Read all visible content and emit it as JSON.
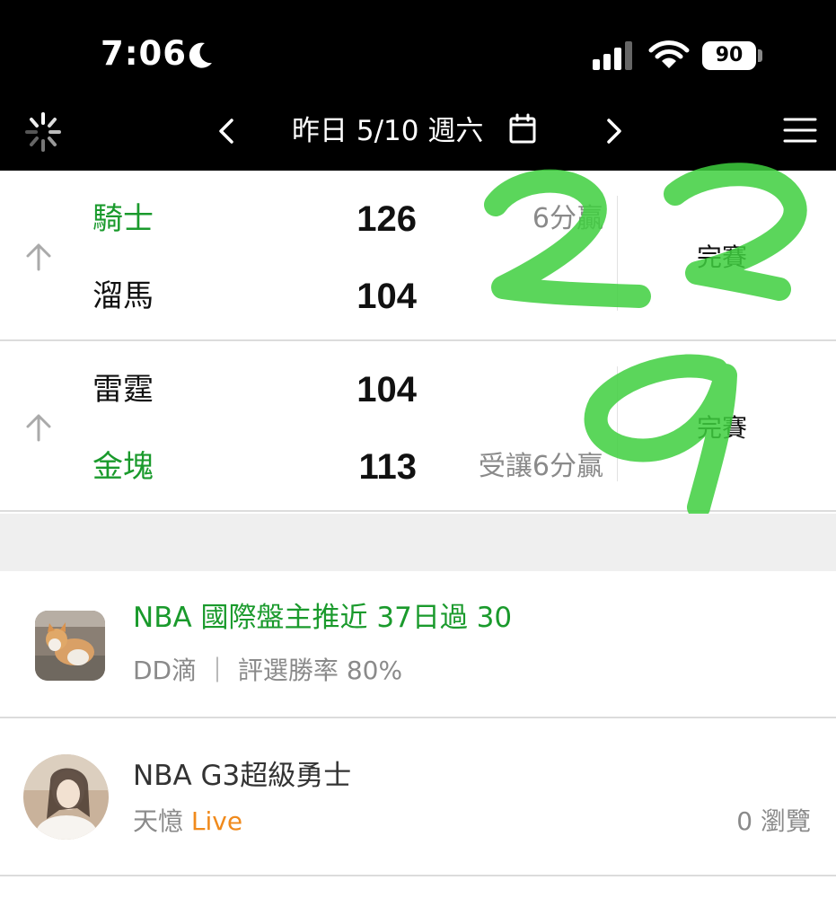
{
  "status_bar": {
    "time": "7:06",
    "battery": "90"
  },
  "nav": {
    "date_title": "昨日 5/10 週六"
  },
  "games": [
    {
      "team_top": "騎士",
      "score_top": "126",
      "result_top": "6分贏",
      "team_bottom": "溜馬",
      "score_bottom": "104",
      "result_bottom": "",
      "status": "完賽",
      "annotation": "22"
    },
    {
      "team_top": "雷霆",
      "score_top": "104",
      "result_top": "",
      "team_bottom": "金塊",
      "score_bottom": "113",
      "result_bottom": "受讓6分贏",
      "status": "完賽",
      "annotation": "9"
    }
  ],
  "articles": [
    {
      "title": "NBA 國際盤主推近 37日過 30",
      "author": "DD滴",
      "meta": "｜ 評選勝率 80%"
    },
    {
      "title": "NBA G3超級勇士",
      "author": "天憶",
      "live": "Live",
      "views": "0 瀏覽"
    }
  ],
  "colors": {
    "win_green": "#1a9a2c",
    "live_orange": "#f08a1c",
    "handwriting_green": "#3ecf3e"
  }
}
